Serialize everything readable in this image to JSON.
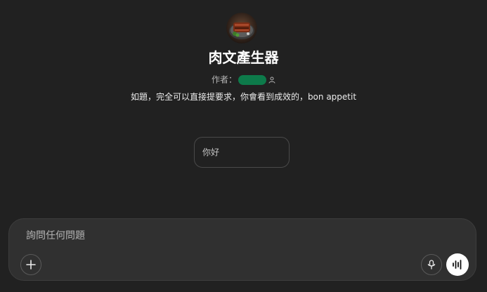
{
  "gpt": {
    "title": "肉文產生器",
    "author_label": "作者：",
    "description": "如題，完全可以直接提要求，你會看到成效的，bon appetit"
  },
  "starters": [
    {
      "label": "你好"
    }
  ],
  "composer": {
    "placeholder": "詢問任何問題",
    "value": ""
  },
  "icons": {
    "avatar": "steak-plate-image",
    "author": "person-icon",
    "attach": "plus-icon",
    "dictate": "microphone-icon",
    "voice": "voice-waveform-icon"
  },
  "colors": {
    "background": "#212121",
    "composer": "#303030",
    "redaction": "#0d7a4a",
    "voice_button": "#ffffff"
  }
}
